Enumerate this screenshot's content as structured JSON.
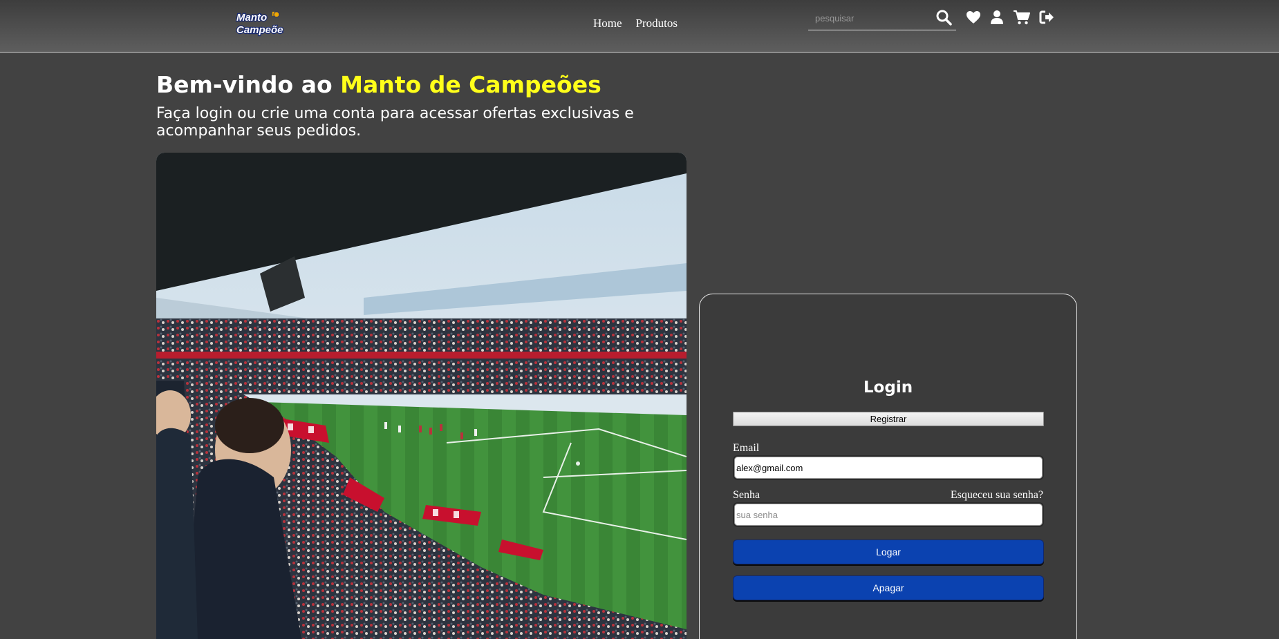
{
  "header": {
    "logo_alt": "Manto de Campeões",
    "logo_line1": "Manto",
    "logo_line2": "Campeões",
    "nav": [
      {
        "label": "Home"
      },
      {
        "label": "Produtos"
      }
    ],
    "search": {
      "placeholder": "pesquisar",
      "value": ""
    },
    "icons": [
      "search-icon",
      "heart-icon",
      "user-icon",
      "cart-icon",
      "logout-icon"
    ]
  },
  "hero": {
    "title_prefix": "Bem-vindo ao ",
    "title_accent": "Manto de Campeões",
    "subtitle": "Faça login ou crie uma conta para acessar ofertas exclusivas e acompanhar seus pedidos."
  },
  "login": {
    "title": "Login",
    "register_label": "Registrar",
    "email_label": "Email",
    "email_value": "alex@gmail.com",
    "password_label": "Senha",
    "forgot_label": "Esqueceu sua senha?",
    "password_placeholder": "sua senha",
    "submit_label": "Logar",
    "clear_label": "Apagar"
  },
  "colors": {
    "background": "#424242",
    "accent_yellow": "#ffff1a",
    "button_blue": "#0b42b0"
  }
}
